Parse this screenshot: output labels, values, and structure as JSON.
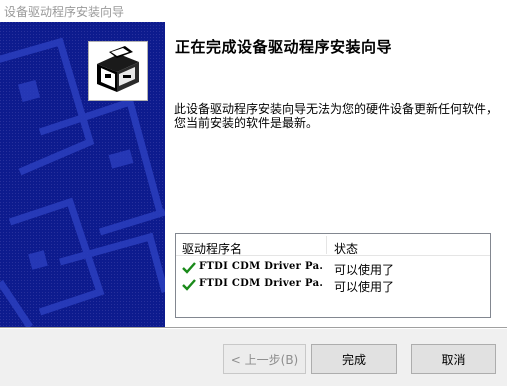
{
  "window": {
    "title": "设备驱动程序安装向导"
  },
  "wizard": {
    "heading": "正在完成设备驱动程序安装向导",
    "message": "此设备驱动程序安装向导无法为您的硬件设备更新任何软件，您当前安装的软件是最新。",
    "banner_icon": "installer-box-icon"
  },
  "driver_list": {
    "columns": [
      "驱动程序名",
      "状态"
    ],
    "rows": [
      {
        "name": "FTDI CDM Driver Pa...",
        "status": "可以使用了",
        "icon": "check-icon"
      },
      {
        "name": "FTDI CDM Driver Pa...",
        "status": "可以使用了",
        "icon": "check-icon"
      }
    ]
  },
  "buttons": {
    "back": "< 上一步(B)",
    "finish": "完成",
    "cancel": "取消"
  },
  "colors": {
    "banner_blue": "#0d1b8e",
    "check_green": "#1a8a1a"
  }
}
